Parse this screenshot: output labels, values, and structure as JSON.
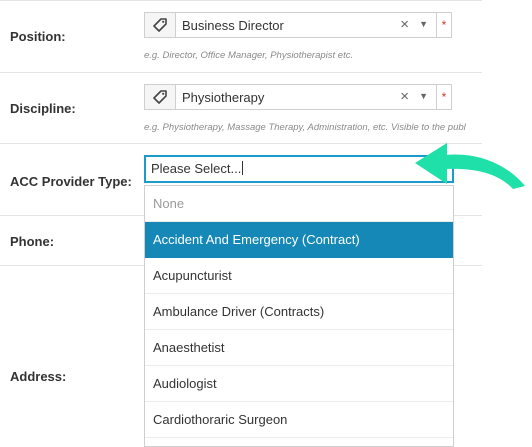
{
  "form": {
    "position": {
      "label": "Position:",
      "value": "Business Director",
      "hint": "e.g. Director, Office Manager, Physiotherapist etc.",
      "required_mark": "*",
      "clear_glyph": "×",
      "caret_glyph": "▼"
    },
    "discipline": {
      "label": "Discipline:",
      "value": "Physiotherapy",
      "hint": "e.g. Physiotherapy, Massage Therapy, Administration, etc. Visible to the publ",
      "required_mark": "*",
      "clear_glyph": "×",
      "caret_glyph": "▼"
    },
    "acc_provider_type": {
      "label": "ACC Provider Type:",
      "value": "Please Select..."
    },
    "phone": {
      "label": "Phone:"
    },
    "address": {
      "label": "Address:"
    }
  },
  "dropdown": {
    "options": [
      "None",
      "Accident And Emergency (Contract)",
      "Acupuncturist",
      "Ambulance Driver (Contracts)",
      "Anaesthetist",
      "Audiologist",
      "Cardiothoraric Surgeon"
    ],
    "highlighted": "Accident And Emergency (Contract)"
  },
  "colors": {
    "focus_border": "#1a9bc9",
    "highlight": "#1588b8",
    "arrow": "#1fe0a8",
    "required": "#d9342b"
  },
  "icons": {
    "tag": "tag-icon",
    "clear": "clear-icon",
    "caret": "chevron-down-icon",
    "annotation": "curved-arrow-icon"
  }
}
